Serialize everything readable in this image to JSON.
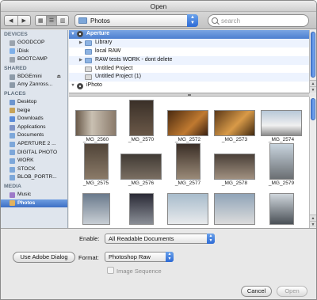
{
  "window": {
    "title": "Open"
  },
  "toolbar": {
    "back_icon": "back-arrow-icon",
    "forward_icon": "forward-arrow-icon",
    "location": "Photos",
    "search_placeholder": "search"
  },
  "sidebar": {
    "sections": [
      {
        "title": "DEVICES",
        "items": [
          {
            "label": "GOODCOP",
            "icon": "hard-disk-icon"
          },
          {
            "label": "iDisk",
            "icon": "idisk-icon"
          },
          {
            "label": "BOOTCAMP",
            "icon": "hard-disk-icon"
          }
        ]
      },
      {
        "title": "SHARED",
        "items": [
          {
            "label": "BDGEmini",
            "icon": "network-computer-icon",
            "eject": "⏏"
          },
          {
            "label": "Amy Zanross...",
            "icon": "network-computer-icon"
          }
        ]
      },
      {
        "title": "PLACES",
        "items": [
          {
            "label": "Desktop",
            "icon": "desktop-icon"
          },
          {
            "label": "beige",
            "icon": "home-icon"
          },
          {
            "label": "Downloads",
            "icon": "downloads-icon"
          },
          {
            "label": "Applications",
            "icon": "applications-icon"
          },
          {
            "label": "Documents",
            "icon": "folder-icon"
          },
          {
            "label": "APERTURE 2 ...",
            "icon": "folder-icon"
          },
          {
            "label": "DIGITAL PHOTO",
            "icon": "folder-icon"
          },
          {
            "label": "WORK",
            "icon": "folder-icon"
          },
          {
            "label": "STOCK",
            "icon": "folder-icon"
          },
          {
            "label": "BLOB_PORTR...",
            "icon": "folder-icon"
          }
        ]
      },
      {
        "title": "MEDIA",
        "items": [
          {
            "label": "Music",
            "icon": "music-icon"
          },
          {
            "label": "Photos",
            "icon": "photos-icon",
            "selected": true
          }
        ]
      }
    ]
  },
  "tree": [
    {
      "label": "Aperture",
      "level": 0,
      "expanded": true,
      "selected": true,
      "icon": "aperture-icon"
    },
    {
      "label": "Library",
      "level": 1,
      "expanded": false,
      "icon": "folder-icon"
    },
    {
      "label": "local RAW",
      "level": 1,
      "icon": "folder-icon"
    },
    {
      "label": "RAW tests WORK - dont delete",
      "level": 1,
      "expanded": false,
      "icon": "folder-icon"
    },
    {
      "label": "Untitled Project",
      "level": 1,
      "icon": "project-icon"
    },
    {
      "label": "Untitled Project (1)",
      "level": 1,
      "icon": "project-icon"
    },
    {
      "label": "iPhoto",
      "level": 0,
      "expanded": true,
      "icon": "iphoto-icon"
    }
  ],
  "thumbnails": [
    {
      "label": "_MG_2560"
    },
    {
      "label": "_MG_2570"
    },
    {
      "label": "_MG_2572"
    },
    {
      "label": "_MG_2573"
    },
    {
      "label": "_MG_2574"
    },
    {
      "label": "_MG_2575"
    },
    {
      "label": "_MG_2576"
    },
    {
      "label": "_MG_2577"
    },
    {
      "label": "_MG_2578"
    },
    {
      "label": "_MG_2579"
    },
    {
      "label": ""
    },
    {
      "label": ""
    },
    {
      "label": ""
    },
    {
      "label": ""
    },
    {
      "label": ""
    }
  ],
  "options": {
    "enable_label": "Enable:",
    "enable_value": "All Readable Documents",
    "adobe_button": "Use Adobe Dialog",
    "format_label": "Format:",
    "format_value": "Photoshop Raw",
    "image_sequence_label": "Image Sequence",
    "image_sequence_checked": false
  },
  "buttons": {
    "cancel": "Cancel",
    "open": "Open"
  }
}
